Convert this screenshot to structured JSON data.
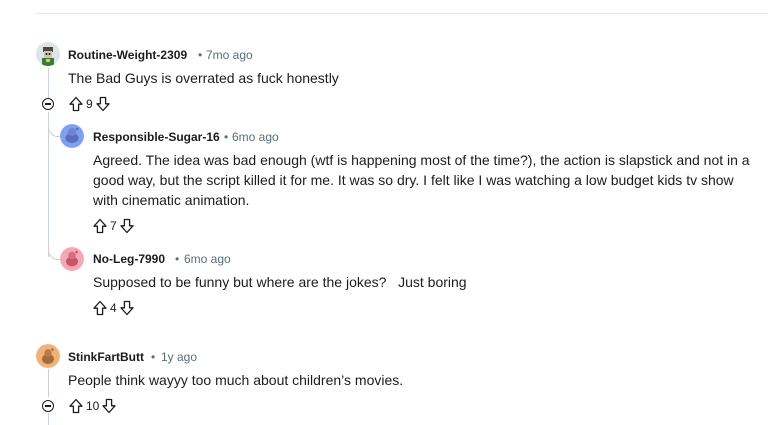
{
  "colors": {
    "meta": "#576f76",
    "text": "#1c1c1c",
    "thread_line": "#c9d1d4"
  },
  "comments": [
    {
      "username": "Routine-Weight-2309",
      "time": "7mo ago",
      "body": "The Bad Guys is overrated as fuck honestly",
      "score": "9",
      "avatar_icon": "snoo-avatar-icon"
    },
    {
      "username": "Responsible-Sugar-16",
      "time": "6mo ago",
      "body": "Agreed. The idea was bad enough (wtf is happening most of the time?), the action is slapstick and not in a good way, but the script killed it for me. It was so dry. I felt like I was watching a low budget kids tv show with cinematic animation.",
      "score": "7",
      "avatar_icon": "snoo-avatar-icon"
    },
    {
      "username": "No-Leg-7990",
      "time": "6mo ago",
      "body": "Supposed to be funny but where are the jokes?   Just boring",
      "score": "4",
      "avatar_icon": "snoo-avatar-icon"
    },
    {
      "username": "StinkFartButt",
      "time": "1y ago",
      "body": "People think wayyy too much about children’s movies.",
      "score": "10",
      "avatar_icon": "snoo-avatar-icon"
    }
  ],
  "separator": "•"
}
